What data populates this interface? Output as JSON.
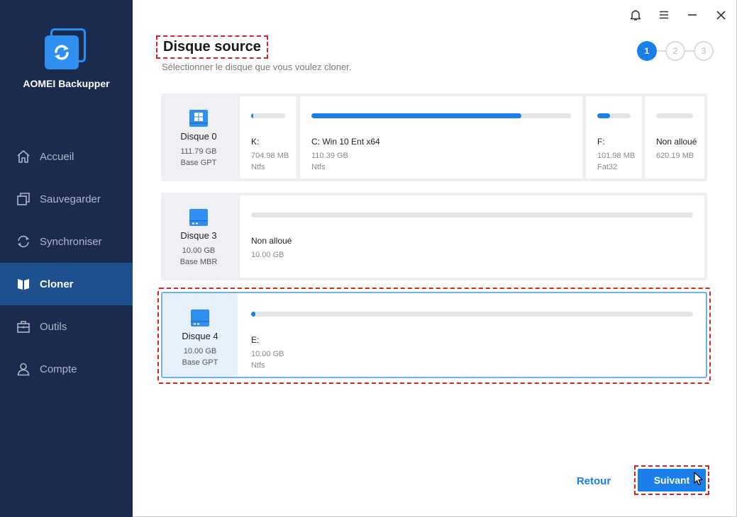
{
  "app": {
    "name": "AOMEI Backupper",
    "logo_icon": "sync-icon",
    "accent": "#1a7fe8",
    "sidebar_bg": "#1b2b4d"
  },
  "window_controls": [
    {
      "icon": "bell-icon"
    },
    {
      "icon": "menu-icon"
    },
    {
      "icon": "minimize-icon"
    },
    {
      "icon": "close-icon"
    }
  ],
  "sidebar": {
    "items": [
      {
        "label": "Accueil",
        "icon": "home-icon",
        "active": false
      },
      {
        "label": "Sauvegarder",
        "icon": "backup-icon",
        "active": false
      },
      {
        "label": "Synchroniser",
        "icon": "sync-icon",
        "active": false
      },
      {
        "label": "Cloner",
        "icon": "clone-icon",
        "active": true
      },
      {
        "label": "Outils",
        "icon": "toolbox-icon",
        "active": false
      },
      {
        "label": "Compte",
        "icon": "user-icon",
        "active": false
      }
    ]
  },
  "header": {
    "title": "Disque source",
    "subtitle": "Sélectionner le disque que vous voulez cloner."
  },
  "steps": [
    {
      "label": "1",
      "active": true
    },
    {
      "label": "2",
      "active": false
    },
    {
      "label": "3",
      "active": false
    }
  ],
  "disks": [
    {
      "name": "Disque 0",
      "size": "111.79 GB",
      "type": "Base GPT",
      "icon": "windows-disk-icon",
      "partitions": [
        {
          "name": "K:",
          "size": "704.98 MB",
          "fs": "Ntfs",
          "used_pct": 6
        },
        {
          "name": "C: Win 10 Ent x64",
          "size": "110.39 GB",
          "fs": "Ntfs",
          "used_pct": 81
        },
        {
          "name": "F:",
          "size": "101.98 MB",
          "fs": "Fat32",
          "used_pct": 38
        },
        {
          "name": "Non alloué",
          "size": "620.19 MB",
          "fs": "",
          "used_pct": 0
        }
      ]
    },
    {
      "name": "Disque 3",
      "size": "10.00 GB",
      "type": "Base MBR",
      "icon": "disk-icon",
      "partitions": [
        {
          "name": "Non alloué",
          "size": "10.00 GB",
          "fs": "",
          "used_pct": 0
        }
      ]
    },
    {
      "name": "Disque 4",
      "size": "10.00 GB",
      "type": "Base GPT",
      "icon": "disk-icon",
      "selected": true,
      "partitions": [
        {
          "name": "E:",
          "size": "10.00 GB",
          "fs": "Ntfs",
          "used_pct": 1
        }
      ]
    }
  ],
  "footer": {
    "back_label": "Retour",
    "next_label": "Suivant"
  }
}
